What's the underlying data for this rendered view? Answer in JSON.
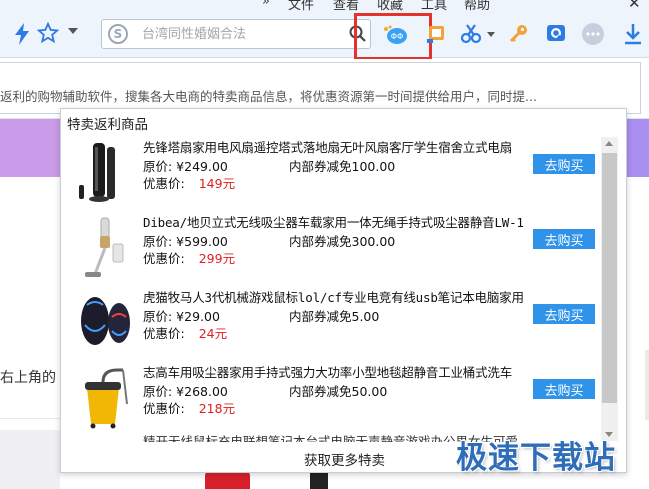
{
  "menu": {
    "overflow_glyph": "»",
    "items": [
      {
        "label": "文件"
      },
      {
        "label": "查看"
      },
      {
        "label": "收藏"
      },
      {
        "label": "工具"
      },
      {
        "label": "帮助"
      }
    ],
    "close_glyph": "✕"
  },
  "toolbar": {
    "search_placeholder": "台湾同性婚姻合法",
    "sogou_glyph": "S",
    "icons": [
      "bolt-icon",
      "star-icon",
      "magnifier-icon",
      "fanli-icon",
      "window-icon",
      "scissors-icon",
      "key-icon",
      "camera-icon",
      "more-icon",
      "download-icon"
    ]
  },
  "infobar": {
    "text": "返利的购物辅助软件，搜集各大电商的特卖商品信息，将优惠资源第一时间提供给用户，同时提..."
  },
  "background": {
    "text": "右上角的"
  },
  "popup": {
    "title": "特卖返利商品",
    "buy_label": "去购买",
    "more_label": "获取更多特卖",
    "items": [
      {
        "title": "先锋塔扇家用电风扇遥控塔式落地扇无叶风扇客厅学生宿舍立式电扇",
        "orig": "原价: ¥249.00",
        "coupon": "内部券减免100.00",
        "discount_label": "优惠价:",
        "discount_price": "149元"
      },
      {
        "title": "Dibea/地贝立式无线吸尘器车载家用一体无绳手持式吸尘器静音LW-1",
        "orig": "原价: ¥599.00",
        "coupon": "内部券减免300.00",
        "discount_label": "优惠价:",
        "discount_price": "299元"
      },
      {
        "title": "虎猫牧马人3代机械游戏鼠标lol/cf专业电竞有线usb笔记本电脑家用",
        "orig": "原价: ¥29.00",
        "coupon": "内部券减免5.00",
        "discount_label": "优惠价:",
        "discount_price": "24元"
      },
      {
        "title": "志高车用吸尘器家用手持式强力大功率小型地毯超静音工业桶式洗车",
        "orig": "原价: ¥268.00",
        "coupon": "内部券减免50.00",
        "discount_label": "优惠价:",
        "discount_price": "218元"
      }
    ],
    "peek_title": "精开无线鼠标充电联想笔记本台式电脑无声静音游戏办公男女生可爱"
  },
  "watermark": {
    "text": "极速下载站"
  },
  "colors": {
    "accent": "#2f93ea",
    "price_red": "#e02020",
    "highlight_red": "#e3332a",
    "toolbar_bg": "#eef4fb"
  }
}
